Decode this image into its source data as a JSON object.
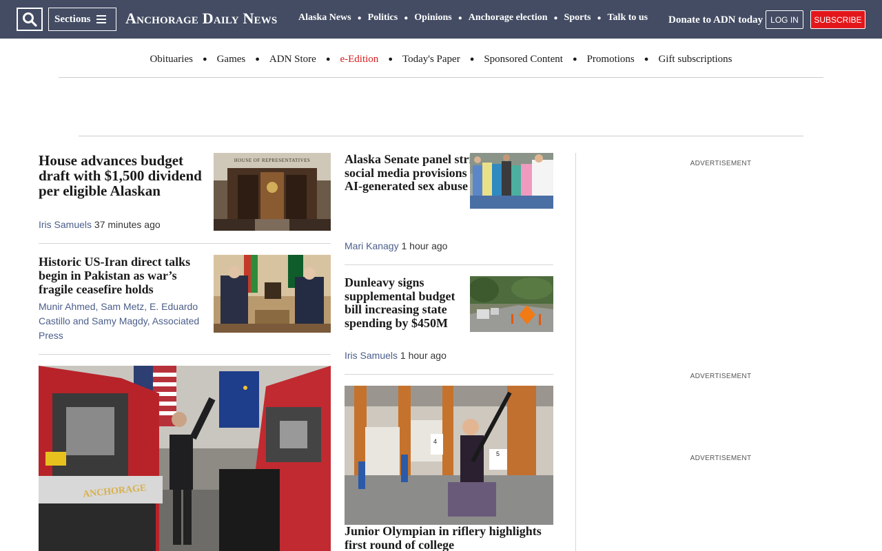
{
  "header": {
    "sections_label": "Sections",
    "logo": "Anchorage Daily News",
    "nav": [
      "Alaska News",
      "Politics",
      "Opinions",
      "Anchorage election",
      "Sports",
      "Talk to us"
    ],
    "donate": "Donate to ADN today",
    "login": "LOG IN",
    "subscribe": "SUBSCRIBE"
  },
  "subnav": [
    "Obituaries",
    "Games",
    "ADN Store",
    "e-Edition",
    "Today's Paper",
    "Sponsored Content",
    "Promotions",
    "Gift subscriptions"
  ],
  "colors": {
    "header_bg": "#434c63",
    "subscribe_bg": "#e3171b",
    "eedition": "#d81818",
    "author": "#4a5d8a"
  },
  "articles": {
    "a1": {
      "headline": "House advances budget draft with $1,500 dividend per eligible Alaskan",
      "author": "Iris Samuels",
      "time": "37 minutes ago",
      "image_sign": "HOUSE OF REPRESENTATIVES"
    },
    "a2": {
      "headline": "Historic US-Iran direct talks begin in Pakistan as war’s fragile ceasefire holds",
      "authors": "Munir Ahmed, Sam Metz, E. Eduardo Castillo and Samy Magdy, Associated Press"
    },
    "a3": {
      "headline": "Alaska Senate panel strips sweeping social media provisions from bill on AI-generated sex abuse material",
      "author": "Mari Kanagy",
      "time": "1 hour ago"
    },
    "a4": {
      "headline": "Dunleavy signs supplemental budget bill increasing state spending by $450M",
      "author": "Iris Samuels",
      "time": "1 hour ago"
    },
    "a5": {
      "truck_text": "ANCHORAGE"
    },
    "a6": {
      "headline": "Junior Olympian in riflery highlights first round of college",
      "lane_numbers": [
        "4",
        "5"
      ]
    }
  },
  "ads": [
    "ADVERTISEMENT",
    "ADVERTISEMENT",
    "ADVERTISEMENT"
  ]
}
